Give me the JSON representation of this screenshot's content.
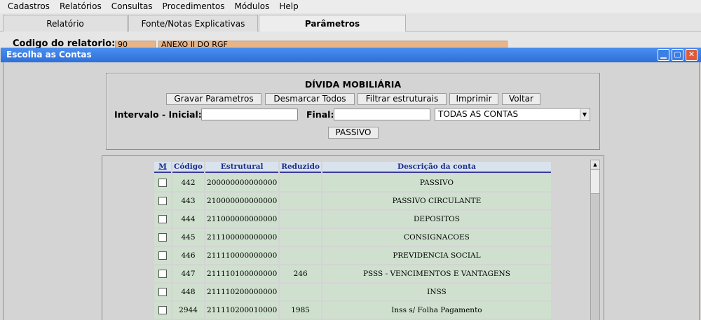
{
  "menubar": {
    "items": [
      "Cadastros",
      "Relatórios",
      "Consultas",
      "Procedimentos",
      "Módulos",
      "Help"
    ]
  },
  "tabs": [
    {
      "label": "Relatório",
      "active": false
    },
    {
      "label": "Fonte/Notas Explicativas",
      "active": false
    },
    {
      "label": "Parâmetros",
      "active": true
    }
  ],
  "background_form": {
    "label": "Codigo do relatorio:",
    "code_value": "90",
    "name_value": "ANEXO II DO RGF"
  },
  "window": {
    "title": "Escolha as Contas",
    "controls": [
      "minimize-icon",
      "maximize-icon",
      "close-icon"
    ]
  },
  "params": {
    "title": "DÍVIDA MOBILIÁRIA",
    "buttons": {
      "gravar": "Gravar Parametros",
      "desmarcar": "Desmarcar Todos",
      "filtrar": "Filtrar estruturais",
      "imprimir": "Imprimir",
      "voltar": "Voltar"
    },
    "intervalo_label": "Intervalo - Inicial:",
    "inicial_value": "",
    "final_label": "Final:",
    "final_value": "",
    "select_value": "TODAS AS CONTAS",
    "passivo_button": "PASSIVO"
  },
  "table": {
    "headers": [
      "M",
      "Código",
      "Estrutural",
      "Reduzido",
      "Descrição da conta"
    ],
    "rows": [
      {
        "checked": false,
        "codigo": "442",
        "estrutural": "200000000000000",
        "reduzido": "",
        "descricao": "PASSIVO"
      },
      {
        "checked": false,
        "codigo": "443",
        "estrutural": "210000000000000",
        "reduzido": "",
        "descricao": "PASSIVO CIRCULANTE"
      },
      {
        "checked": false,
        "codigo": "444",
        "estrutural": "211000000000000",
        "reduzido": "",
        "descricao": "DEPOSITOS"
      },
      {
        "checked": false,
        "codigo": "445",
        "estrutural": "211100000000000",
        "reduzido": "",
        "descricao": "CONSIGNACOES"
      },
      {
        "checked": false,
        "codigo": "446",
        "estrutural": "211110000000000",
        "reduzido": "",
        "descricao": "PREVIDENCIA SOCIAL"
      },
      {
        "checked": false,
        "codigo": "447",
        "estrutural": "211110100000000",
        "reduzido": "246",
        "descricao": "PSSS - VENCIMENTOS E VANTAGENS"
      },
      {
        "checked": false,
        "codigo": "448",
        "estrutural": "211110200000000",
        "reduzido": "",
        "descricao": "INSS"
      },
      {
        "checked": false,
        "codigo": "2944",
        "estrutural": "211110200010000",
        "reduzido": "1985",
        "descricao": "Inss s/ Folha Pagamento"
      }
    ]
  },
  "colors": {
    "titlebar": "#2f6fd8",
    "row_bg": "#cfe0cf",
    "header_text": "#1a2d8a",
    "field_orange": "#e8b48a"
  }
}
